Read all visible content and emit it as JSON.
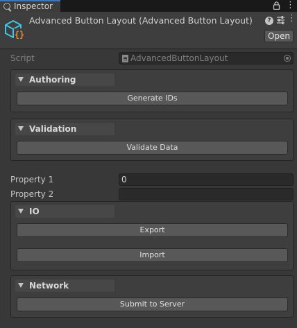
{
  "window": {
    "tab_label": "Inspector"
  },
  "header": {
    "title": "Advanced Button Layout (Advanced Button Layout)",
    "open_label": "Open"
  },
  "script": {
    "label": "Script",
    "value": "AdvancedButtonLayout"
  },
  "groups": {
    "authoring": {
      "title": "Authoring",
      "buttons": [
        "Generate IDs"
      ]
    },
    "validation": {
      "title": "Validation",
      "buttons": [
        "Validate Data"
      ]
    },
    "io": {
      "title": "IO",
      "buttons": [
        "Export",
        "Import"
      ]
    },
    "network": {
      "title": "Network",
      "buttons": [
        "Submit to Server"
      ]
    }
  },
  "properties": [
    {
      "label": "Property 1",
      "value": "0"
    },
    {
      "label": "Property 2",
      "value": ""
    }
  ],
  "colors": {
    "background": "#383838",
    "tab_accent": "#3a79bb",
    "icon_cyan": "#3ec6e4",
    "icon_orange": "#f08a1f"
  }
}
